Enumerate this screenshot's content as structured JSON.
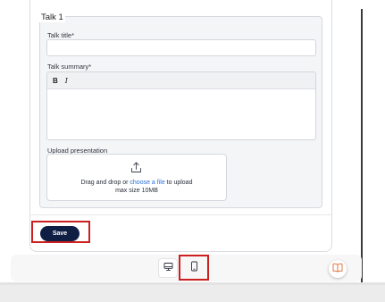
{
  "talk": {
    "legend": "Talk 1",
    "title_label": "Talk title*",
    "title_value": "",
    "summary_label": "Talk summary*",
    "toolbar": {
      "bold": "B",
      "italic": "I"
    },
    "upload_label": "Upload presentation",
    "upload_text_before": "Drag and drop or ",
    "upload_link": "choose a file",
    "upload_text_after": " to upload",
    "upload_size": "max size 10MB"
  },
  "actions": {
    "save_label": "Save"
  },
  "device_toggle": {
    "selected": "mobile"
  },
  "icons": {
    "upload": "upload-icon",
    "desktop": "desktop-icon",
    "mobile": "mobile-icon",
    "book": "book-icon"
  },
  "colors": {
    "save_button": "#0f1f44",
    "link": "#2a6fd6",
    "highlight": "#cc1f1f",
    "book_icon": "#e0662e"
  }
}
